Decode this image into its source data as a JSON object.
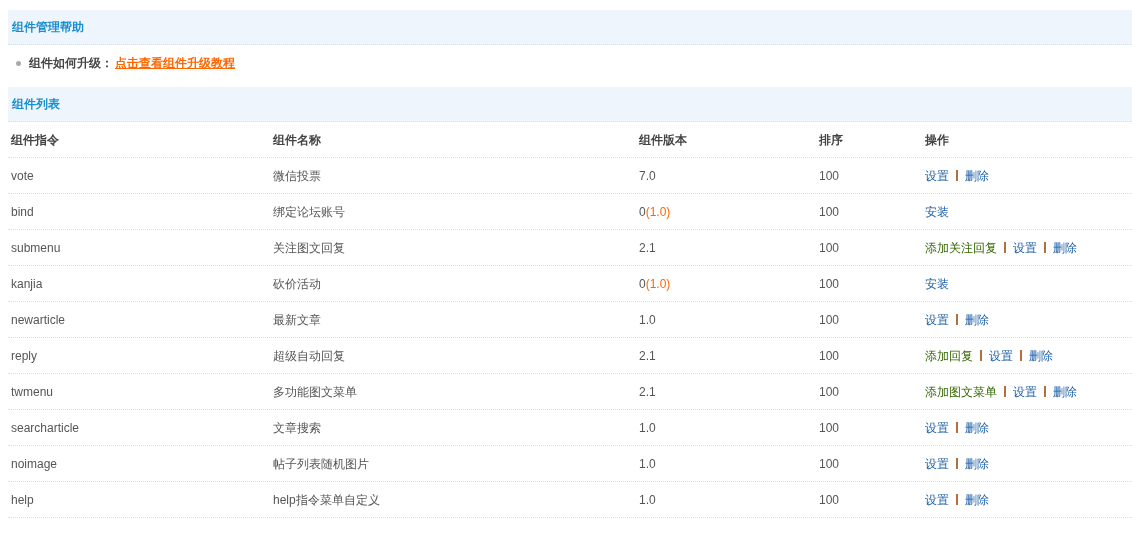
{
  "help_section": {
    "title": "组件管理帮助",
    "items": [
      {
        "label": "组件如何升级：",
        "link": "点击查看组件升级教程"
      }
    ]
  },
  "list_section": {
    "title": "组件列表"
  },
  "table": {
    "columns": [
      "组件指令",
      "组件名称",
      "组件版本",
      "排序",
      "操作"
    ],
    "rows": [
      {
        "command": "vote",
        "name": "微信投票",
        "version": "7.0",
        "order": "100",
        "actions": [
          {
            "label": "设置",
            "kind": "normal"
          },
          {
            "label": "删除",
            "kind": "normal"
          }
        ]
      },
      {
        "command": "bind",
        "name": "绑定论坛账号",
        "version": "0",
        "latest": "(1.0)",
        "order": "100",
        "actions": [
          {
            "label": "安装",
            "kind": "normal"
          }
        ]
      },
      {
        "command": "submenu",
        "name": "关注图文回复",
        "version": "2.1",
        "order": "100",
        "actions": [
          {
            "label": "添加关注回复",
            "kind": "add"
          },
          {
            "label": "设置",
            "kind": "normal"
          },
          {
            "label": "删除",
            "kind": "normal"
          }
        ]
      },
      {
        "command": "kanjia",
        "name": "砍价活动",
        "version": "0",
        "latest": "(1.0)",
        "order": "100",
        "actions": [
          {
            "label": "安装",
            "kind": "normal"
          }
        ]
      },
      {
        "command": "newarticle",
        "name": "最新文章",
        "version": "1.0",
        "order": "100",
        "actions": [
          {
            "label": "设置",
            "kind": "normal"
          },
          {
            "label": "删除",
            "kind": "normal"
          }
        ]
      },
      {
        "command": "reply",
        "name": "超级自动回复",
        "version": "2.1",
        "order": "100",
        "actions": [
          {
            "label": "添加回复",
            "kind": "add"
          },
          {
            "label": "设置",
            "kind": "normal"
          },
          {
            "label": "删除",
            "kind": "normal"
          }
        ]
      },
      {
        "command": "twmenu",
        "name": "多功能图文菜单",
        "version": "2.1",
        "order": "100",
        "actions": [
          {
            "label": "添加图文菜单",
            "kind": "add"
          },
          {
            "label": "设置",
            "kind": "normal"
          },
          {
            "label": "删除",
            "kind": "normal"
          }
        ]
      },
      {
        "command": "searcharticle",
        "name": "文章搜索",
        "version": "1.0",
        "order": "100",
        "actions": [
          {
            "label": "设置",
            "kind": "normal"
          },
          {
            "label": "删除",
            "kind": "normal"
          }
        ]
      },
      {
        "command": "noimage",
        "name": "帖子列表随机图片",
        "version": "1.0",
        "order": "100",
        "actions": [
          {
            "label": "设置",
            "kind": "normal"
          },
          {
            "label": "删除",
            "kind": "normal"
          }
        ]
      },
      {
        "command": "help",
        "name": "help指令菜单自定义",
        "version": "1.0",
        "order": "100",
        "actions": [
          {
            "label": "设置",
            "kind": "normal"
          },
          {
            "label": "删除",
            "kind": "normal"
          }
        ]
      }
    ]
  }
}
